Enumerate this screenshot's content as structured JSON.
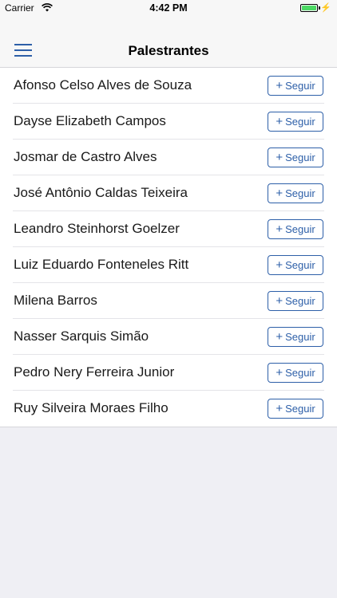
{
  "status": {
    "carrier": "Carrier",
    "time": "4:42 PM",
    "charging_icon": "lightning-bolt"
  },
  "nav": {
    "title": "Palestrantes",
    "menu_icon": "hamburger-menu"
  },
  "speakers": [
    {
      "name": "Afonso Celso Alves de Souza",
      "button": "Seguir"
    },
    {
      "name": "Dayse Elizabeth Campos",
      "button": "Seguir"
    },
    {
      "name": "Josmar de Castro Alves",
      "button": "Seguir"
    },
    {
      "name": "José Antônio Caldas Teixeira",
      "button": "Seguir"
    },
    {
      "name": "Leandro Steinhorst Goelzer",
      "button": "Seguir"
    },
    {
      "name": "Luiz Eduardo Fonteneles Ritt",
      "button": "Seguir"
    },
    {
      "name": "Milena Barros",
      "button": "Seguir"
    },
    {
      "name": "Nasser Sarquis Simão",
      "button": "Seguir"
    },
    {
      "name": "Pedro Nery Ferreira Junior",
      "button": "Seguir"
    },
    {
      "name": "Ruy Silveira Moraes Filho",
      "button": "Seguir"
    }
  ],
  "colors": {
    "accent": "#2d5fa8",
    "battery": "#4cd964"
  }
}
